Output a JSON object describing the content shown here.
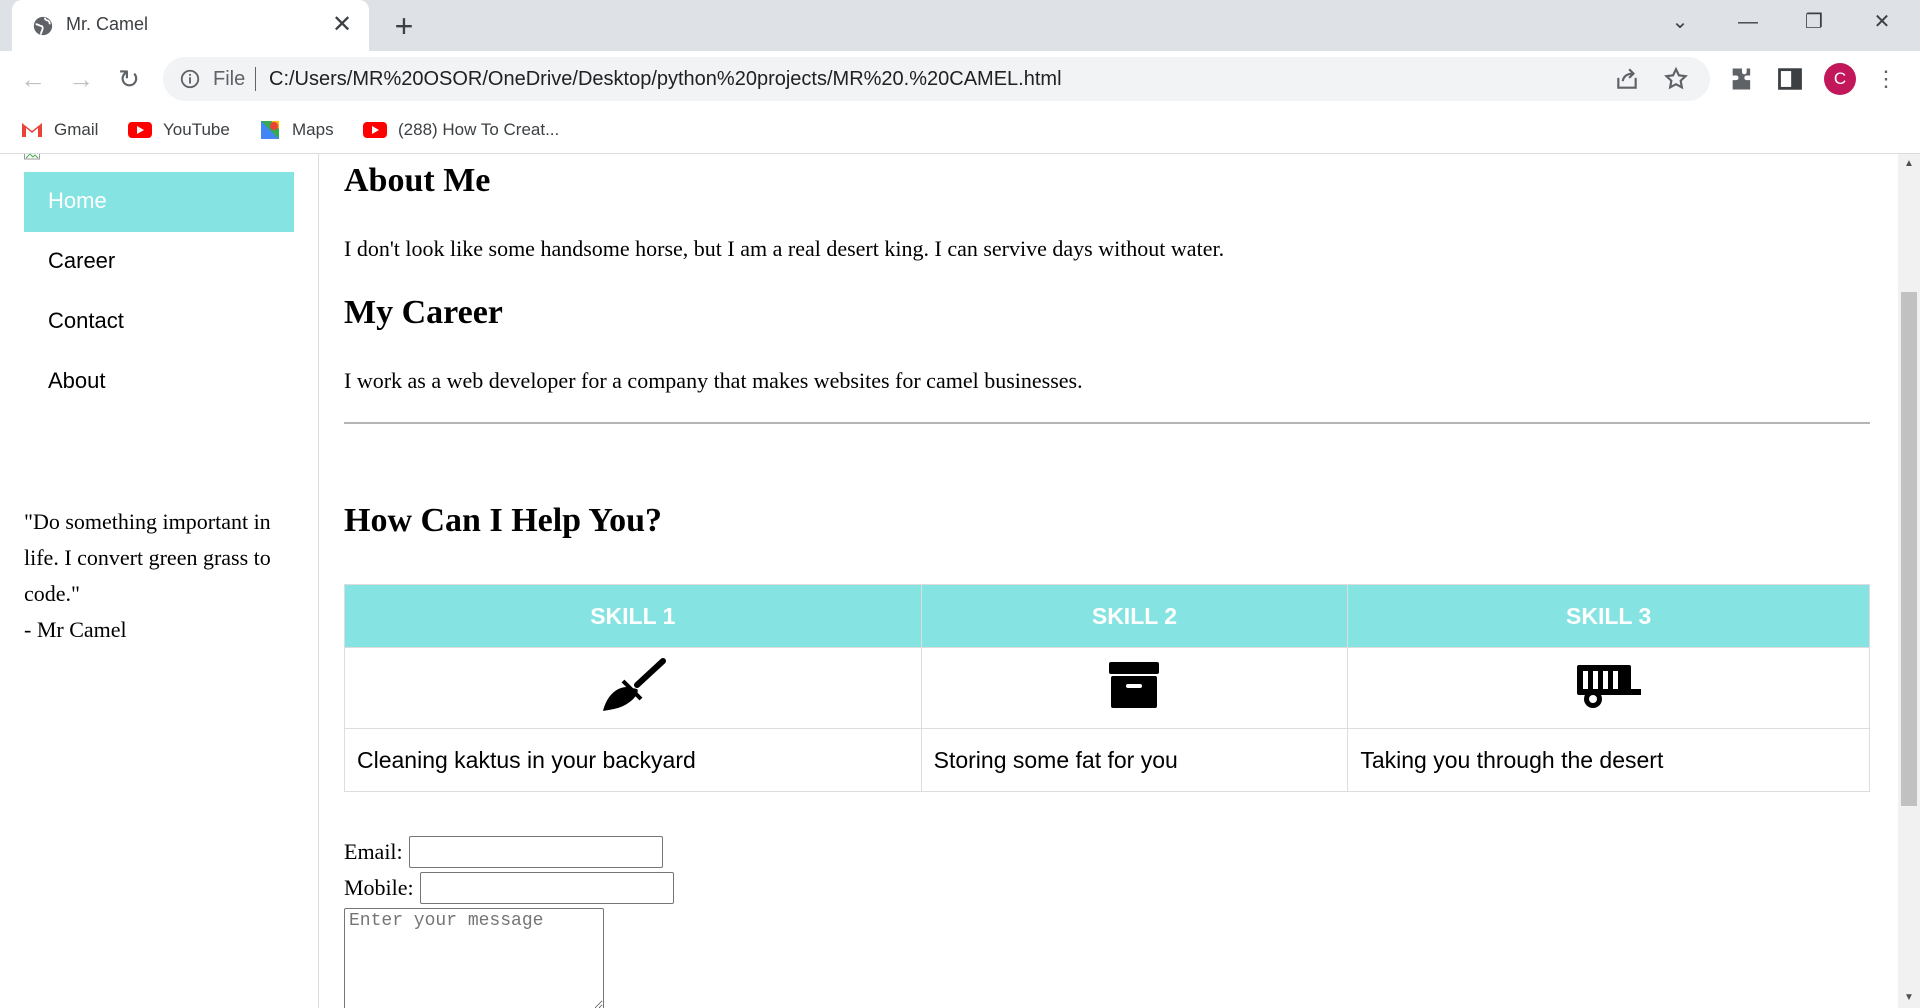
{
  "browser": {
    "tab_title": "Mr. Camel",
    "new_tab": "+",
    "address_scheme": "File",
    "url": "C:/Users/MR%20OSOR/OneDrive/Desktop/python%20projects/MR%20.%20CAMEL.html",
    "avatar_letter": "C",
    "bookmarks": [
      {
        "label": "Gmail",
        "icon": "gmail-icon"
      },
      {
        "label": "YouTube",
        "icon": "youtube-icon"
      },
      {
        "label": "Maps",
        "icon": "maps-icon"
      },
      {
        "label": "(288) How To Creat...",
        "icon": "youtube-icon"
      }
    ]
  },
  "sidebar": {
    "nav": [
      {
        "label": "Home",
        "active": true
      },
      {
        "label": "Career",
        "active": false
      },
      {
        "label": "Contact",
        "active": false
      },
      {
        "label": "About",
        "active": false
      }
    ],
    "quote_line1": "\"Do something important in life. I convert green grass to code.\"",
    "quote_author": "- Mr Camel"
  },
  "main": {
    "about_heading": "About Me",
    "about_text": "I don't look like some handsome horse, but I am a real desert king. I can servive days without water.",
    "career_heading": "My Career",
    "career_text": "I work as a web developer for a company that makes websites for camel businesses.",
    "help_heading": "How Can I Help You?",
    "skills": [
      {
        "header": "SKILL 1",
        "icon": "broom-icon",
        "text": "Cleaning kaktus in your backyard"
      },
      {
        "header": "SKILL 2",
        "icon": "archive-box-icon",
        "text": "Storing some fat for you"
      },
      {
        "header": "SKILL 3",
        "icon": "trailer-icon",
        "text": "Taking you through the desert"
      }
    ]
  },
  "form": {
    "email_label": "Email:",
    "email_value": "",
    "mobile_label": "Mobile:",
    "mobile_value": "",
    "message_placeholder": "Enter your message"
  },
  "colors": {
    "accent": "#85e3e1",
    "avatar": "#c2185b"
  }
}
